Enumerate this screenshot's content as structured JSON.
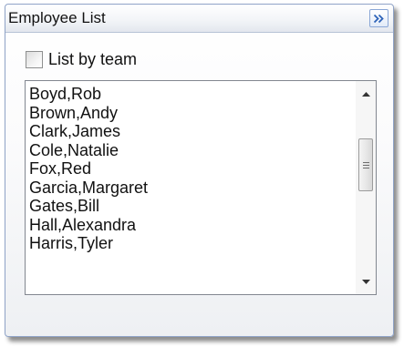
{
  "panel": {
    "title": "Employee List",
    "collapse_icon": "double-chevron-right-icon"
  },
  "filter": {
    "checkbox_label": "List by team",
    "checked": false
  },
  "employees": [
    "Boyd,Rob",
    "Brown,Andy",
    "Clark,James",
    "Cole,Natalie",
    "Fox,Red",
    "Garcia,Margaret",
    "Gates,Bill",
    "Hall,Alexandra",
    "Harris,Tyler"
  ],
  "colors": {
    "border_accent": "#8fa3c7",
    "button_icon": "#2d63b8"
  }
}
